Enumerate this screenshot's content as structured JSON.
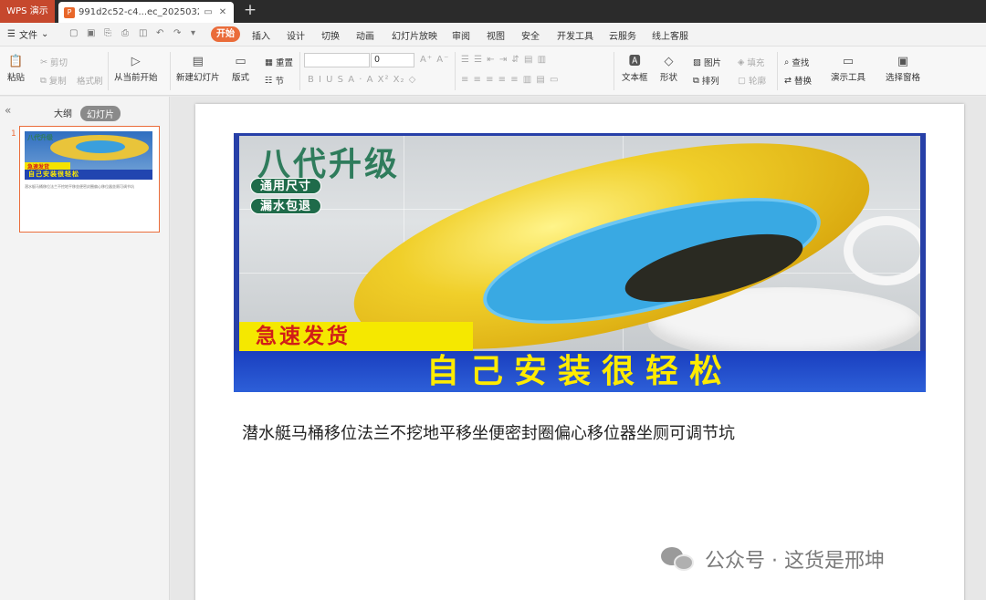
{
  "titlebar": {
    "app_name": "WPS 演示",
    "doc_name": "991d2c52-c4...ec_20250323",
    "doc_icon": "P",
    "new_tab": "+"
  },
  "menubar": {
    "file_label": "文件",
    "active_tab": "开始",
    "items": [
      "插入",
      "设计",
      "切换",
      "动画",
      "幻灯片放映",
      "审阅",
      "视图",
      "安全",
      "开发工具",
      "云服务",
      "线上客服"
    ]
  },
  "ribbon": {
    "paste": "粘贴",
    "cut": "剪切",
    "copy": "复制",
    "format_painter": "格式刷",
    "from_current": "从当前开始",
    "new_slide": "新建幻灯片",
    "layout": "版式",
    "reset": "重置",
    "section": "节",
    "font_size_value": "0",
    "text_box": "文本框",
    "shape": "形状",
    "picture": "图片",
    "arrange": "排列",
    "fill": "填充",
    "outline": "轮廓",
    "find": "查找",
    "replace": "替换",
    "presentation_tools": "演示工具",
    "selection_pane": "选择窗格"
  },
  "left_panel": {
    "tab_outline": "大纲",
    "tab_slides": "幻灯片",
    "slide_number": "1"
  },
  "slide": {
    "image_headline": "八代升级",
    "badge_1": "通用尺寸",
    "badge_2": "漏水包退",
    "banner_red": "急速发货",
    "banner_blue": "自己安装很轻松",
    "caption": "潜水艇马桶移位法兰不挖地平移坐便密封圈偏心移位器坐厕可调节坑"
  },
  "watermark": {
    "text": "公众号 · 这货是邢坤"
  }
}
